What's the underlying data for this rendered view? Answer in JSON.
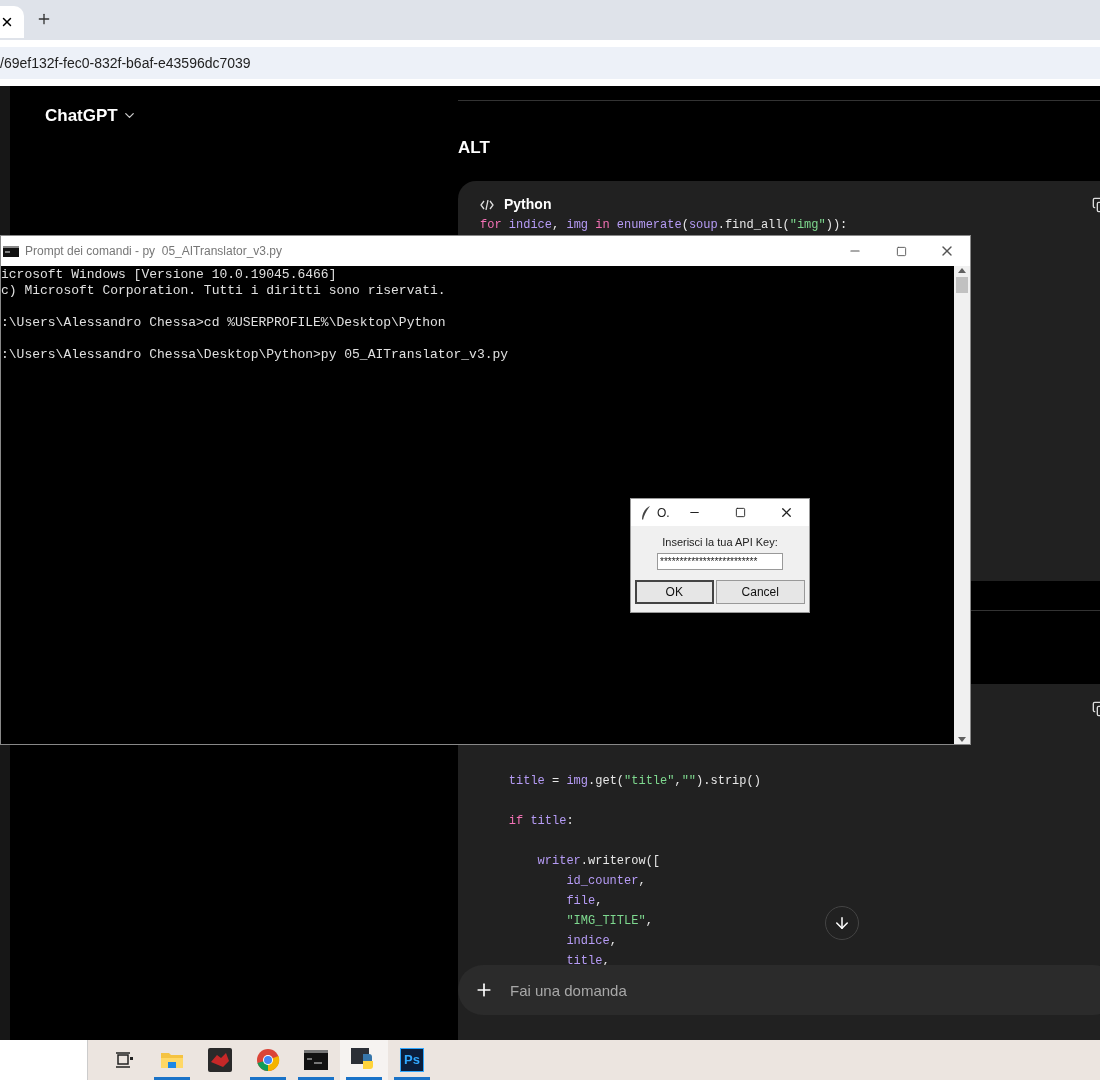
{
  "browser": {
    "url": "/69ef132f-fec0-832f-b6af-e43596dc7039"
  },
  "chatgpt": {
    "brand": "ChatGPT",
    "heading": "ALT",
    "code_block": {
      "language": "Python",
      "lines": [
        {
          "space_after": false,
          "tokens": [
            {
              "kind": "kw",
              "text": "for "
            },
            {
              "kind": "var",
              "text": "indice"
            },
            {
              "kind": "plain",
              "text": ", "
            },
            {
              "kind": "var",
              "text": "img "
            },
            {
              "kind": "kw",
              "text": "in "
            },
            {
              "kind": "var",
              "text": "enumerate"
            },
            {
              "kind": "plain",
              "text": "("
            },
            {
              "kind": "var",
              "text": "soup"
            },
            {
              "kind": "plain",
              "text": ".find_all("
            },
            {
              "kind": "str",
              "text": "\"img\""
            },
            {
              "kind": "plain",
              "text": ")):"
            }
          ]
        }
      ]
    },
    "code_block_2": {
      "lines": [
        {
          "space_after": true,
          "tokens": [
            {
              "kind": "var",
              "text": "    title"
            },
            {
              "kind": "plain",
              "text": " = "
            },
            {
              "kind": "var",
              "text": "img"
            },
            {
              "kind": "plain",
              "text": ".get("
            },
            {
              "kind": "str",
              "text": "\"title\""
            },
            {
              "kind": "plain",
              "text": ","
            },
            {
              "kind": "str",
              "text": "\"\""
            },
            {
              "kind": "plain",
              "text": ").strip()"
            }
          ]
        },
        {
          "space_after": true,
          "tokens": [
            {
              "kind": "kw",
              "text": "    if "
            },
            {
              "kind": "var",
              "text": "title"
            },
            {
              "kind": "plain",
              "text": ":"
            }
          ]
        },
        {
          "space_after": false,
          "tokens": [
            {
              "kind": "var",
              "text": "        writer"
            },
            {
              "kind": "plain",
              "text": ".writerow(["
            }
          ]
        },
        {
          "space_after": false,
          "tokens": [
            {
              "kind": "var",
              "text": "            id_counter"
            },
            {
              "kind": "plain",
              "text": ","
            }
          ]
        },
        {
          "space_after": false,
          "tokens": [
            {
              "kind": "var",
              "text": "            file"
            },
            {
              "kind": "plain",
              "text": ","
            }
          ]
        },
        {
          "space_after": false,
          "tokens": [
            {
              "kind": "str",
              "text": "            \"IMG_TITLE\""
            },
            {
              "kind": "plain",
              "text": ","
            }
          ]
        },
        {
          "space_after": false,
          "tokens": [
            {
              "kind": "var",
              "text": "            indice"
            },
            {
              "kind": "plain",
              "text": ","
            }
          ]
        },
        {
          "space_after": false,
          "tokens": [
            {
              "kind": "var",
              "text": "            title"
            },
            {
              "kind": "plain",
              "text": ","
            }
          ]
        }
      ]
    },
    "message_input": {
      "placeholder": "Fai una domanda"
    }
  },
  "console": {
    "title": "Prompt dei comandi - py  05_AITranslator_v3.py",
    "lines": [
      {
        "text": "icrosoft Windows [Versione 10.0.19045.6466]",
        "space_after": false
      },
      {
        "text": "c) Microsoft Corporation. Tutti i diritti sono riservati.",
        "space_after": true
      },
      {
        "text": ":\\Users\\Alessandro Chessa>cd %USERPROFILE%\\Desktop\\Python",
        "space_after": true
      },
      {
        "text": ":\\Users\\Alessandro Chessa\\Desktop\\Python>py 05_AITranslator_v3.py",
        "space_after": false
      }
    ]
  },
  "dialog": {
    "title": "O.",
    "label": "Inserisci la tua API Key:",
    "value": "*************************",
    "buttons": [
      {
        "label": "OK",
        "default": true
      },
      {
        "label": "Cancel",
        "default": false
      }
    ]
  },
  "taskbar": {
    "apps": [
      {
        "kind": "task_view",
        "running": false,
        "selected": false
      },
      {
        "kind": "folder",
        "running": true,
        "selected": false
      },
      {
        "kind": "red_app",
        "running": false,
        "selected": false
      },
      {
        "kind": "chrome",
        "running": true,
        "selected": false
      },
      {
        "kind": "terminal",
        "running": true,
        "selected": false
      },
      {
        "kind": "python",
        "running": true,
        "selected": true
      },
      {
        "kind": "ps",
        "label": "Ps",
        "running": true,
        "selected": false
      }
    ]
  }
}
